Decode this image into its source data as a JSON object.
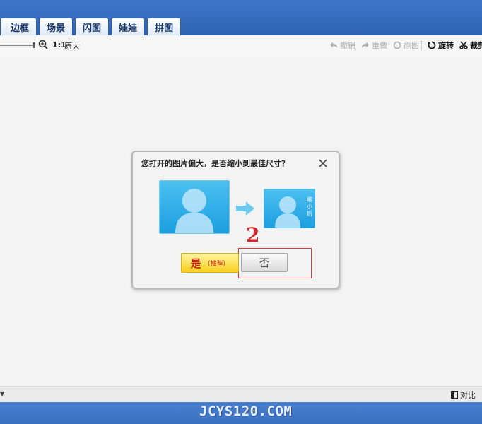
{
  "tabs": [
    "边框",
    "场景",
    "闪图",
    "娃娃",
    "拼图"
  ],
  "toolbar": {
    "ratio_label": "1:1",
    "original_label": "原大",
    "undo": "撤销",
    "redo": "重做",
    "original_image": "原图",
    "rotate": "旋转",
    "crop": "裁剪"
  },
  "dialog": {
    "title": "您打开的图片偏大，是否缩小到最佳尺寸？",
    "after_caption": "缩小后",
    "yes_label": "是",
    "yes_sub": "（推荐）",
    "no_label": "否"
  },
  "annotation": {
    "step_number": "2"
  },
  "statusbar": {
    "compare_label": "对比"
  },
  "watermark": "JCYS120.COM",
  "colors": {
    "title_blue": "#2f63b2",
    "thumb_blue": "#1c9fe0",
    "yes_yellow": "#f7cf1b",
    "annotation_red": "#d2282e"
  }
}
